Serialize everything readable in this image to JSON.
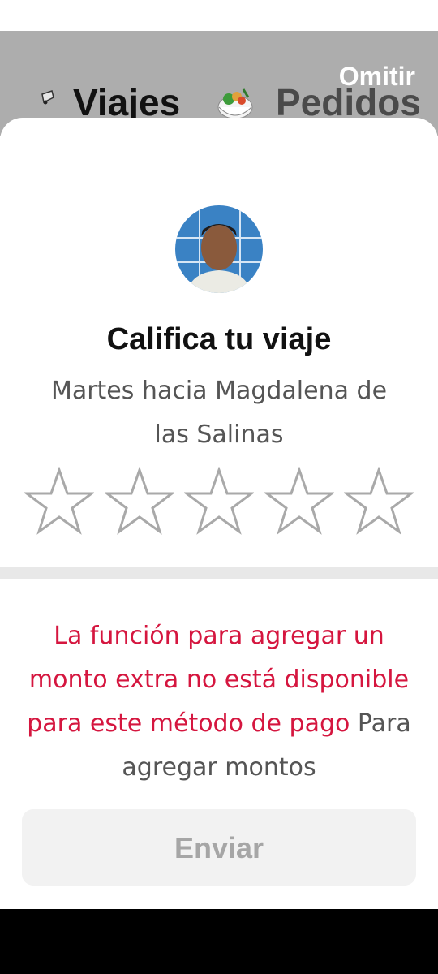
{
  "header": {
    "tabs": [
      {
        "label": "Viajes",
        "active": true
      },
      {
        "label": "Pedidos",
        "active": false
      }
    ],
    "skip_label": "Omitir"
  },
  "rating": {
    "title": "Califica tu viaje",
    "subtitle": "Martes hacia Magdalena de las Salinas",
    "stars_total": 5,
    "stars_selected": 0
  },
  "notice": {
    "error_text": "La función para agregar un monto extra no está disponible para este método de pago",
    "info_text": "Para agregar montos"
  },
  "actions": {
    "submit_label": "Enviar"
  },
  "colors": {
    "error": "#d5163f",
    "header_bg": "#adadad",
    "button_bg": "#f2f2f2"
  },
  "icons": [
    "car-icon",
    "food-bowl-icon",
    "star-outline-icon",
    "driver-avatar"
  ]
}
